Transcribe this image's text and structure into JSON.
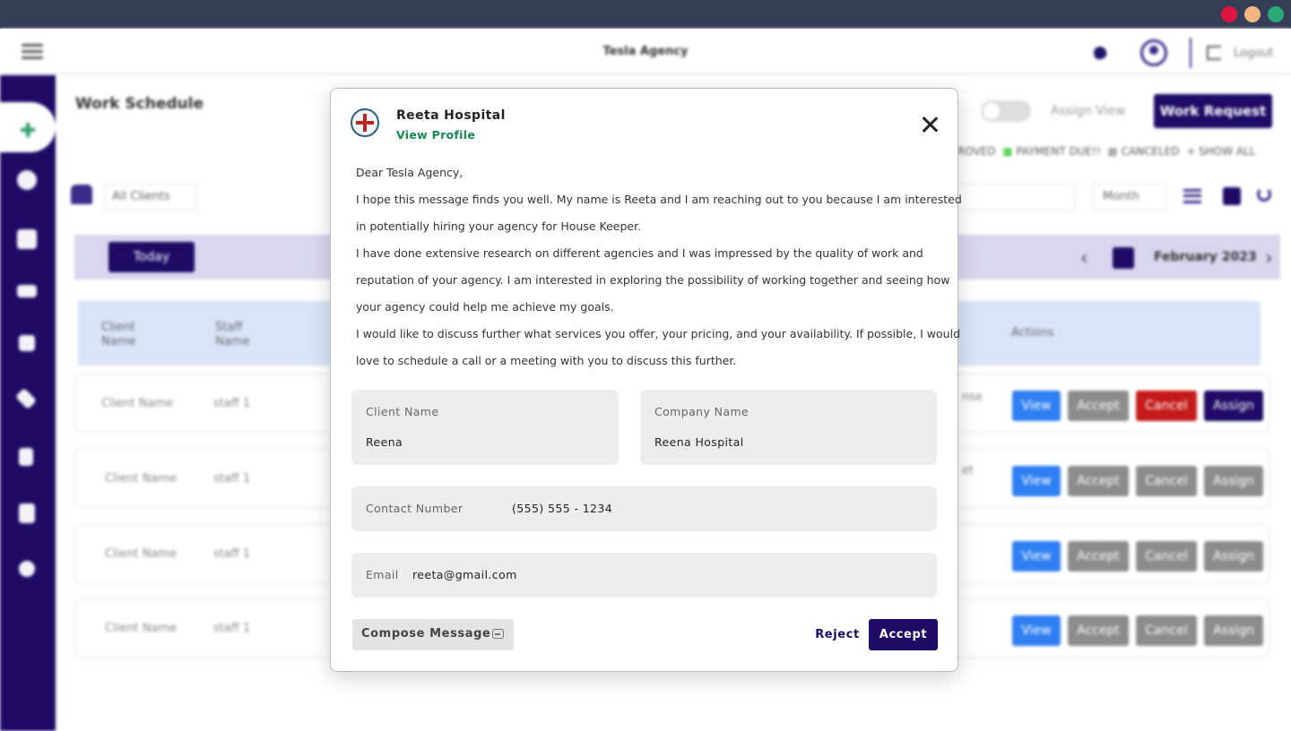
{
  "app": {
    "title": "Tesla Agency",
    "logout_label": "Logout",
    "colors": {
      "primary": "#1f0a66",
      "accent_green": "#17864f",
      "view_blue": "#2f7ff2",
      "cancel_red": "#c41a1a"
    }
  },
  "page": {
    "title": "Work Schedule",
    "assign_view_label": "Assign View",
    "work_request_label": "Work Request",
    "legend": [
      "ROVED",
      "PAYMENT DUE!!",
      "CANCELED",
      "SHOW ALL"
    ],
    "clients_filter": "All Clients",
    "range_select": "Month",
    "today_label": "Today",
    "current_month": "February 2023"
  },
  "table": {
    "headers": {
      "client": "Client Name",
      "staff": "Staff Name",
      "actions": "Actions"
    },
    "rows": [
      {
        "client": "Client Name",
        "staff": "staff 1",
        "status_fragment": "nse"
      },
      {
        "client": "Client Name",
        "staff": "staff 1",
        "status_fragment": "et"
      },
      {
        "client": "Client Name",
        "staff": "staff 1",
        "status_fragment": ""
      },
      {
        "client": "Client Name",
        "staff": "staff 1",
        "status_fragment": ""
      }
    ],
    "action_labels": {
      "view": "View",
      "accept": "Accept",
      "cancel": "Cancel",
      "assign": "Assign"
    }
  },
  "modal": {
    "hospital_name": "Reeta Hospital",
    "view_profile": "View Profile",
    "message": [
      "Dear Tesla Agency,",
      "I hope this message finds you well. My name is Reeta and I am reaching out to you because I am interested",
      "in potentially hiring your agency for House Keeper.",
      "I have done extensive research on different agencies and I was impressed by the quality of work and",
      "reputation of your agency. I am interested in exploring the possibility of working together and seeing how",
      "your agency could help me achieve my goals.",
      "I would like to discuss further what services you offer, your pricing, and your availability. If possible, I would",
      "love to schedule a call or a meeting with you to discuss this further."
    ],
    "client_name_label": "Client Name",
    "client_name_value": "Reena",
    "company_name_label": "Company Name",
    "company_name_value": "Reena Hospital",
    "contact_label": "Contact Number",
    "contact_value": "(555) 555 - 1234",
    "email_label": "Email",
    "email_value": "reeta@gmail.com",
    "compose_label": "Compose Message",
    "reject_label": "Reject",
    "accept_label": "Accept"
  }
}
